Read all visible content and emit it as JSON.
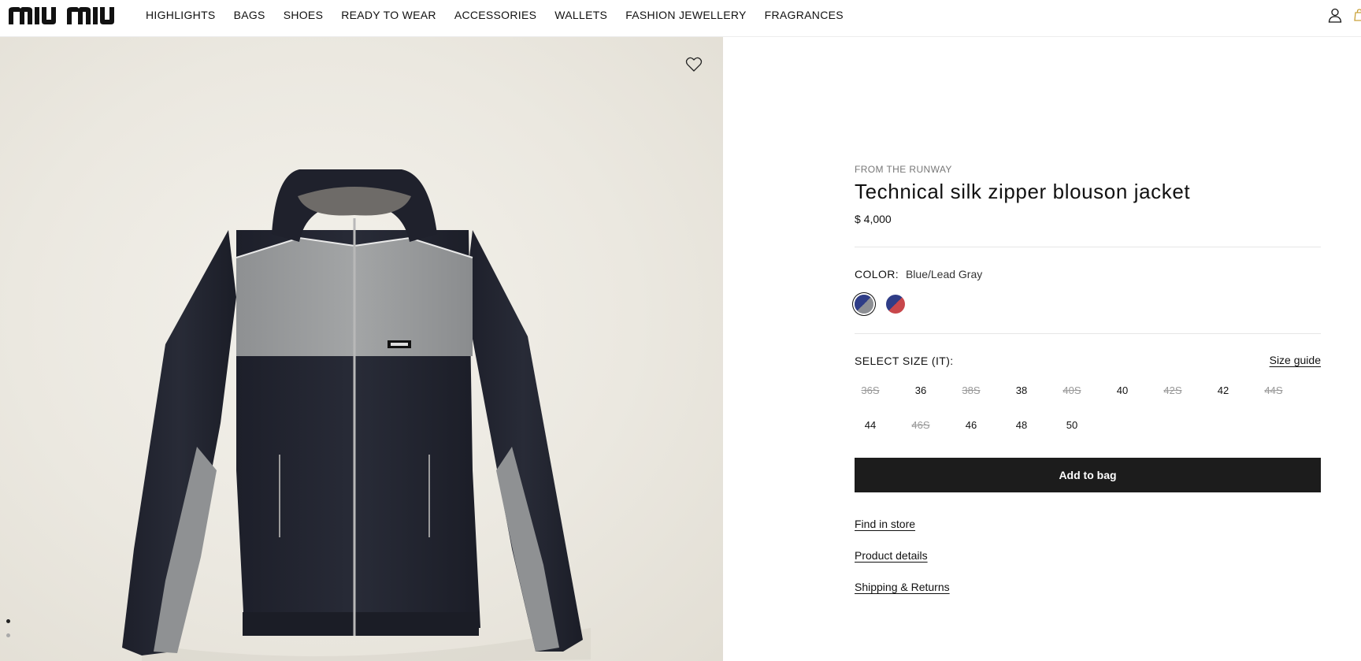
{
  "brand": {
    "logo_text": "MIU MIU"
  },
  "nav": {
    "items": [
      {
        "label": "HIGHLIGHTS"
      },
      {
        "label": "BAGS"
      },
      {
        "label": "SHOES"
      },
      {
        "label": "READY TO WEAR"
      },
      {
        "label": "ACCESSORIES"
      },
      {
        "label": "WALLETS"
      },
      {
        "label": "FASHION JEWELLERY"
      },
      {
        "label": "FRAGRANCES"
      }
    ]
  },
  "header_icons": [
    "account-icon",
    "bag-icon"
  ],
  "gallery": {
    "icons": [
      "heart-icon"
    ],
    "carousel_active_index": 0,
    "carousel_count": 2
  },
  "product": {
    "eyebrow": "FROM THE RUNWAY",
    "title": "Technical silk zipper blouson jacket",
    "price": "$ 4,000",
    "color_label": "COLOR:",
    "color_value": "Blue/Lead Gray",
    "swatches": [
      {
        "name": "Blue/Lead Gray",
        "colors": [
          "#2f3d87",
          "#8d8f94"
        ],
        "selected": true
      },
      {
        "name": "Blue/Red",
        "colors": [
          "#2f3d87",
          "#c8474b"
        ],
        "selected": false
      }
    ],
    "size_label": "SELECT SIZE (IT):",
    "size_guide": "Size guide",
    "sizes": [
      {
        "label": "36S",
        "available": false
      },
      {
        "label": "36",
        "available": true
      },
      {
        "label": "38S",
        "available": false
      },
      {
        "label": "38",
        "available": true
      },
      {
        "label": "40S",
        "available": false
      },
      {
        "label": "40",
        "available": true
      },
      {
        "label": "42S",
        "available": false
      },
      {
        "label": "42",
        "available": true
      },
      {
        "label": "44S",
        "available": false
      },
      {
        "label": "44",
        "available": true
      },
      {
        "label": "46S",
        "available": false
      },
      {
        "label": "46",
        "available": true
      },
      {
        "label": "48",
        "available": true
      },
      {
        "label": "50",
        "available": true
      }
    ],
    "add_to_bag": "Add to bag",
    "links": {
      "find_in_store": "Find in store",
      "product_details": "Product details",
      "shipping_returns": "Shipping & Returns"
    }
  },
  "colors": {
    "accent_button": "#1c1c1c",
    "unavailable_size": "#999999"
  }
}
